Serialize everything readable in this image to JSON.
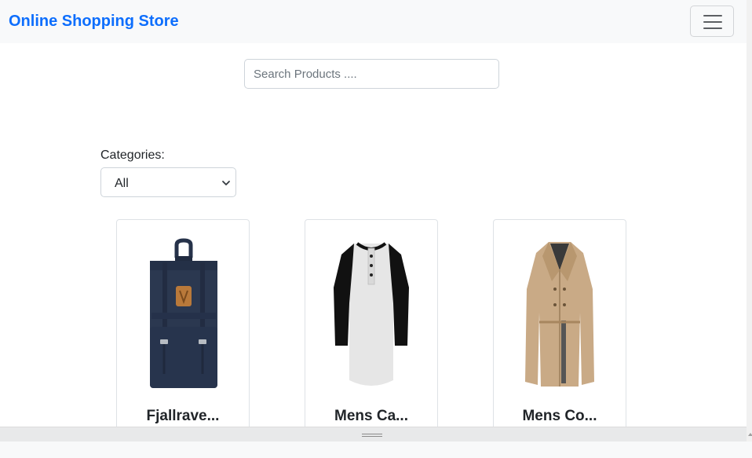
{
  "navbar": {
    "brand": "Online Shopping Store",
    "toggler_icon": "hamburger-menu-icon"
  },
  "search": {
    "placeholder": "Search Products ....",
    "value": ""
  },
  "categories": {
    "label": "Categories:",
    "selected": "All",
    "chevron_icon": "chevron-down-icon"
  },
  "products": [
    {
      "title": "Fjallrave...",
      "image": "backpack"
    },
    {
      "title": "Mens Ca...",
      "image": "raglan-henley-shirt"
    },
    {
      "title": "Mens Co...",
      "image": "trench-coat"
    }
  ],
  "colors": {
    "brand": "#0d6efd",
    "backpack": "#2b3850",
    "shirt_body": "#e6e6e6",
    "shirt_sleeves": "#111111",
    "coat": "#c9aa86"
  }
}
